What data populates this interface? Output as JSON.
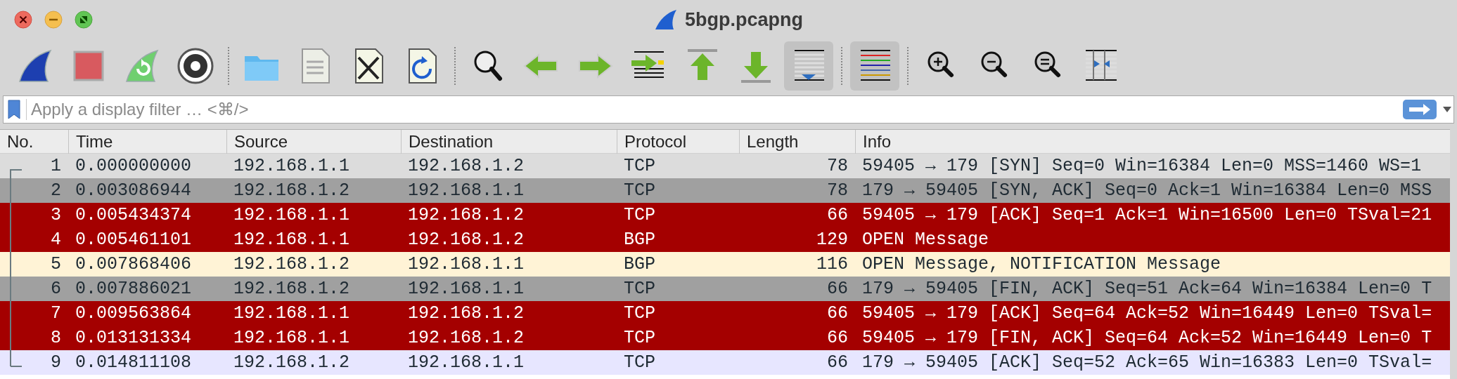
{
  "window": {
    "title": "5bgp.pcapng"
  },
  "toolbar": {
    "groups": [
      [
        {
          "on": false
        },
        {
          "on": false
        },
        {
          "on": false
        },
        {
          "on": false
        }
      ],
      [
        {
          "on": false
        },
        {
          "on": false
        },
        {
          "on": false
        },
        {
          "on": false
        }
      ],
      [
        {
          "on": false
        },
        {
          "on": false
        },
        {
          "on": false
        },
        {
          "on": false
        },
        {
          "on": false
        },
        {
          "on": false
        },
        {
          "on": true
        }
      ],
      [
        {
          "on": true
        }
      ],
      [
        {
          "on": false
        },
        {
          "on": false
        },
        {
          "on": false
        },
        {
          "on": false
        }
      ]
    ]
  },
  "filter": {
    "placeholder": "Apply a display filter … <⌘/>"
  },
  "table": {
    "columns": [
      "No.",
      "Time",
      "Source",
      "Destination",
      "Protocol",
      "Length",
      "Info"
    ],
    "rows": [
      {
        "no": "1",
        "time": "0.000000000",
        "source": "192.168.1.1",
        "destination": "192.168.1.2",
        "protocol": "TCP",
        "length": "78",
        "info": "59405 → 179 [SYN] Seq=0 Win=16384 Len=0 MSS=1460 WS=1",
        "color": "#dcdcdc"
      },
      {
        "no": "2",
        "time": "0.003086944",
        "source": "192.168.1.2",
        "destination": "192.168.1.1",
        "protocol": "TCP",
        "length": "78",
        "info": "179 → 59405 [SYN, ACK] Seq=0 Ack=1 Win=16384 Len=0 MSS",
        "color": "#a0a0a0"
      },
      {
        "no": "3",
        "time": "0.005434374",
        "source": "192.168.1.1",
        "destination": "192.168.1.2",
        "protocol": "TCP",
        "length": "66",
        "info": "59405 → 179 [ACK] Seq=1 Ack=1 Win=16500 Len=0 TSval=21",
        "color": "#a40000"
      },
      {
        "no": "4",
        "time": "0.005461101",
        "source": "192.168.1.1",
        "destination": "192.168.1.2",
        "protocol": "BGP",
        "length": "129",
        "info": "OPEN Message",
        "color": "#a40000"
      },
      {
        "no": "5",
        "time": "0.007868406",
        "source": "192.168.1.2",
        "destination": "192.168.1.1",
        "protocol": "BGP",
        "length": "116",
        "info": "OPEN Message, NOTIFICATION Message",
        "color": "#fff3d6"
      },
      {
        "no": "6",
        "time": "0.007886021",
        "source": "192.168.1.2",
        "destination": "192.168.1.1",
        "protocol": "TCP",
        "length": "66",
        "info": "179 → 59405 [FIN, ACK] Seq=51 Ack=64 Win=16384 Len=0 T",
        "color": "#a0a0a0"
      },
      {
        "no": "7",
        "time": "0.009563864",
        "source": "192.168.1.1",
        "destination": "192.168.1.2",
        "protocol": "TCP",
        "length": "66",
        "info": "59405 → 179 [ACK] Seq=64 Ack=52 Win=16449 Len=0 TSval=",
        "color": "#a40000"
      },
      {
        "no": "8",
        "time": "0.013131334",
        "source": "192.168.1.1",
        "destination": "192.168.1.2",
        "protocol": "TCP",
        "length": "66",
        "info": "59405 → 179 [FIN, ACK] Seq=64 Ack=52 Win=16449 Len=0 T",
        "color": "#a40000"
      },
      {
        "no": "9",
        "time": "0.014811108",
        "source": "192.168.1.2",
        "destination": "192.168.1.1",
        "protocol": "TCP",
        "length": "66",
        "info": "179 → 59405 [ACK] Seq=52 Ack=65 Win=16383 Len=0 TSval=",
        "color": "#e7e6ff"
      }
    ]
  }
}
